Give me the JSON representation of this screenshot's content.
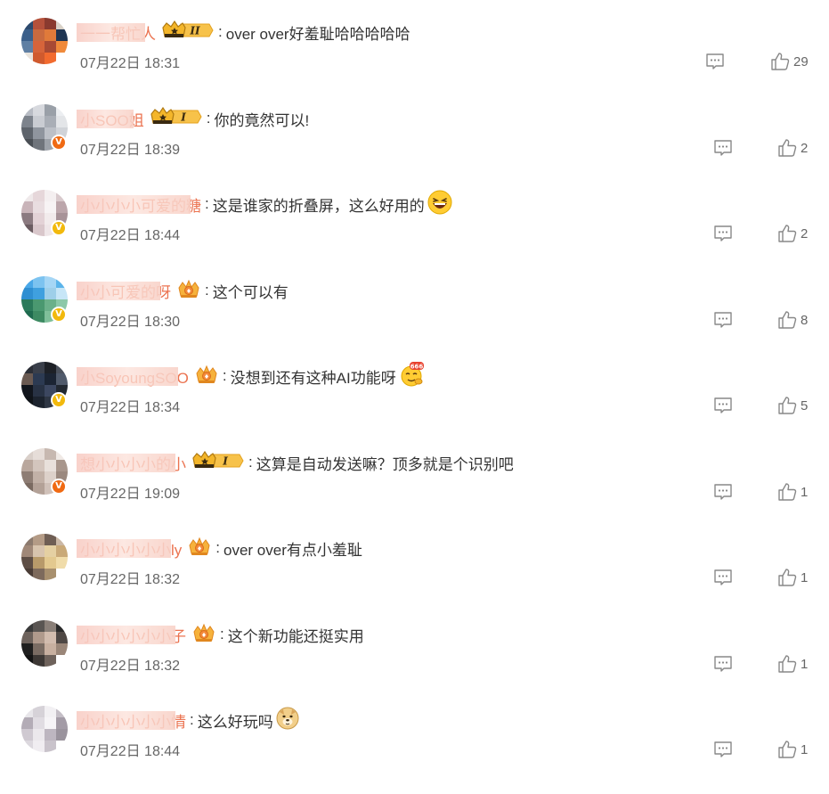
{
  "comments": [
    {
      "username": "一一帮忙人",
      "level_badge": "II",
      "text": "over over好羞耻哈哈哈哈哈",
      "emoji": "",
      "time": "07月22日 18:31",
      "likes": "29",
      "verified": ""
    },
    {
      "username": "小SOO姐",
      "level_badge": "I",
      "text": "你的竟然可以!",
      "emoji": "",
      "time": "07月22日 18:39",
      "likes": "2",
      "verified": "orange"
    },
    {
      "username": "小小小小可爱的糖",
      "level_badge": "",
      "text": "这是谁家的折叠屏，这么好用的",
      "emoji": "laughing-face",
      "time": "07月22日 18:44",
      "likes": "2",
      "verified": "gold"
    },
    {
      "username": "小小可爱的呀",
      "level_badge": "crown",
      "text": "这个可以有",
      "emoji": "",
      "time": "07月22日 18:30",
      "likes": "8",
      "verified": "gold"
    },
    {
      "username": "小SoyoungSOO",
      "level_badge": "crown",
      "text": "没想到还有这种AI功能呀",
      "emoji": "666-face",
      "time": "07月22日 18:34",
      "likes": "5",
      "verified": "gold"
    },
    {
      "username": "想小小小小的小",
      "level_badge": "I",
      "text": "这算是自动发送嘛？顶多就是个识别吧",
      "emoji": "",
      "time": "07月22日 19:09",
      "likes": "1",
      "verified": "orange"
    },
    {
      "username": "小小小小小小ly",
      "level_badge": "crown",
      "text": "over over有点小羞耻",
      "emoji": "",
      "time": "07月22日 18:32",
      "likes": "1",
      "verified": ""
    },
    {
      "username": "小小小小小小子",
      "level_badge": "crown",
      "text": "这个新功能还挺实用",
      "emoji": "",
      "time": "07月22日 18:32",
      "likes": "1",
      "verified": ""
    },
    {
      "username": "小小小小小小情",
      "level_badge": "",
      "text": "这么好玩吗",
      "emoji": "doge-face",
      "time": "07月22日 18:44",
      "likes": "1",
      "verified": ""
    }
  ],
  "colors": {
    "username": "#eb7350",
    "text": "#333333",
    "time": "#666666",
    "icon": "#888888"
  }
}
